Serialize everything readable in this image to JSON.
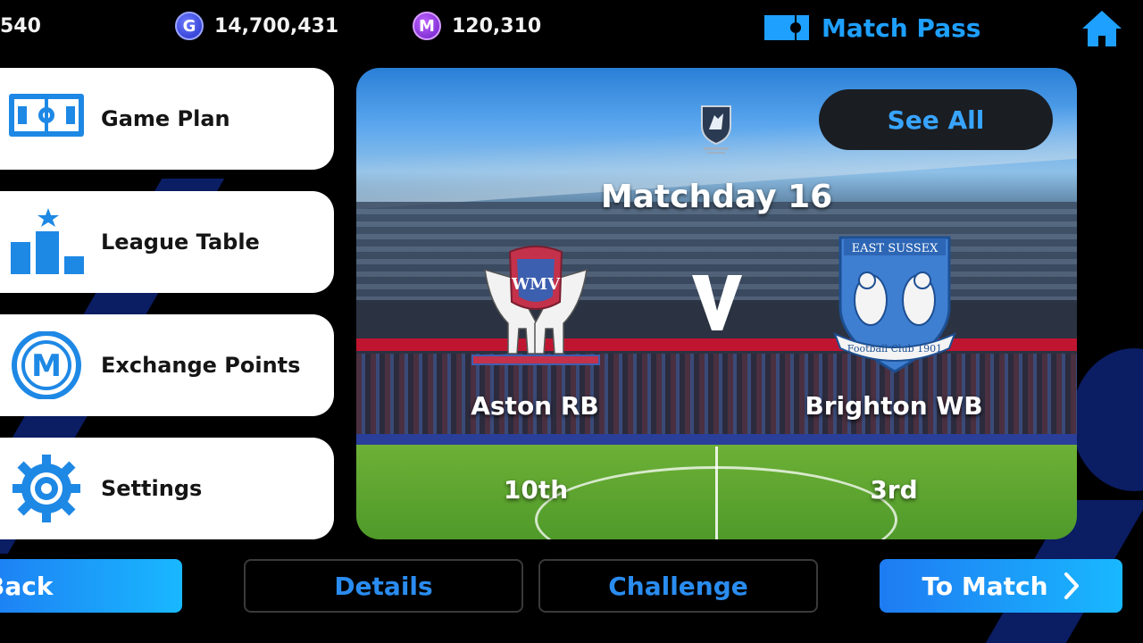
{
  "top_bar": {
    "points_partial": "540",
    "gp_coin_glyph": "G",
    "gp_amount": "14,700,431",
    "coin_glyph": "M",
    "coin_amount": "120,310",
    "match_pass_label": "Match Pass",
    "home_icon": "home-icon"
  },
  "menu": [
    {
      "label": "Game Plan",
      "icon": "formation-icon"
    },
    {
      "label": "League Table",
      "icon": "podium-icon"
    },
    {
      "label": "Exchange Points",
      "icon": "points-icon"
    },
    {
      "label": "Settings",
      "icon": "gear-icon"
    }
  ],
  "match": {
    "see_all_label": "See All",
    "matchday_title": "Matchday 16",
    "versus_glyph": "V",
    "home_team": {
      "name": "Aston RB",
      "rank": "10th",
      "crest_text": "WMV"
    },
    "away_team": {
      "name": "Brighton WB",
      "rank": "3rd",
      "crest_top": "EAST SUSSEX",
      "crest_bottom": "Football Club 1901"
    }
  },
  "bottom_bar": {
    "back_label": "Back",
    "details_label": "Details",
    "challenge_label": "Challenge",
    "to_match_label": "To Match"
  },
  "colors": {
    "accent": "#1ea0ff",
    "card_bg": "#ffffff",
    "button_gradient_start": "#1e7bf2",
    "button_gradient_end": "#19b8ff"
  }
}
